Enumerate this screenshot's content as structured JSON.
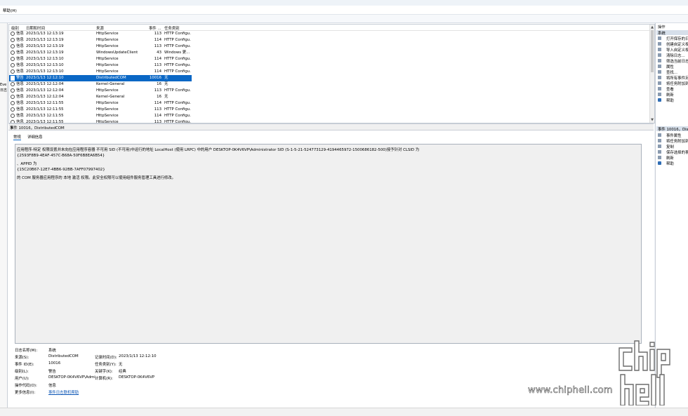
{
  "menu": {
    "help_label": "帮助(H)"
  },
  "left_pane": {
    "items": [
      "Eve",
      "日志"
    ]
  },
  "list": {
    "columns": {
      "level": "级别",
      "datetime": "日期和时间",
      "source": "来源",
      "event_id": "事件 ...",
      "task": "任务类别"
    },
    "rows": [
      {
        "level": "信息",
        "datetime": "2023/1/13 12:13:19",
        "source": "HttpService",
        "event_id": "113",
        "task": "HTTP Configu..."
      },
      {
        "level": "信息",
        "datetime": "2023/1/13 12:13:19",
        "source": "HttpService",
        "event_id": "114",
        "task": "HTTP Configu..."
      },
      {
        "level": "信息",
        "datetime": "2023/1/13 12:13:19",
        "source": "HttpService",
        "event_id": "113",
        "task": "HTTP Configu..."
      },
      {
        "level": "信息",
        "datetime": "2023/1/13 12:13:19",
        "source": "WindowsUpdateClient",
        "event_id": "43",
        "task": "Windows 更..."
      },
      {
        "level": "信息",
        "datetime": "2023/1/13 12:13:10",
        "source": "HttpService",
        "event_id": "114",
        "task": "HTTP Configu..."
      },
      {
        "level": "信息",
        "datetime": "2023/1/13 12:13:10",
        "source": "HttpService",
        "event_id": "113",
        "task": "HTTP Configu..."
      },
      {
        "level": "信息",
        "datetime": "2023/1/13 12:13:10",
        "source": "HttpService",
        "event_id": "114",
        "task": "HTTP Configu..."
      },
      {
        "level": "警告",
        "datetime": "2023/1/13 12:12:10",
        "source": "DistributedCOM",
        "event_id": "10016",
        "task": "无"
      },
      {
        "level": "信息",
        "datetime": "2023/1/13 12:12:04",
        "source": "Kernel-General",
        "event_id": "16",
        "task": "无"
      },
      {
        "level": "信息",
        "datetime": "2023/1/13 12:12:04",
        "source": "HttpService",
        "event_id": "113",
        "task": "HTTP Configu..."
      },
      {
        "level": "信息",
        "datetime": "2023/1/13 12:12:04",
        "source": "Kernel-General",
        "event_id": "16",
        "task": "无"
      },
      {
        "level": "信息",
        "datetime": "2023/1/13 12:11:55",
        "source": "HttpService",
        "event_id": "114",
        "task": "HTTP Configu..."
      },
      {
        "level": "信息",
        "datetime": "2023/1/13 12:11:55",
        "source": "HttpService",
        "event_id": "113",
        "task": "HTTP Configu..."
      },
      {
        "level": "信息",
        "datetime": "2023/1/13 12:11:55",
        "source": "HttpService",
        "event_id": "114",
        "task": "HTTP Configu..."
      },
      {
        "level": "信息",
        "datetime": "2023/1/13 12:11:55",
        "source": "HttpService",
        "event_id": "113",
        "task": "HTTP Configu..."
      }
    ]
  },
  "detail": {
    "title": "事件 10016，DistributedCOM",
    "tabs": [
      "常规",
      "详细信息"
    ],
    "description": [
      "应用程序-特定 权限设置并未向在应用程序容器 不可用 SID (不可用)中运行的地址 LocalHost (使用 LRPC) 中的用户 DESKTOP-0K4V6VP\\Administrator SID (S-1-5-21-524773129-4194465972-1500686182-500)授予针对 CLSID 为",
      "{2593F8B9-4EAF-457C-B68A-50F6B8EA6B54}",
      "、APPID 为",
      "{15C20B67-12E7-4BB6-92BB-7AFF07997402}",
      "的 COM 服务器应用程序的 本地 激活 权限。此安全权限可以使用组件服务管理工具进行修改。"
    ],
    "fields": {
      "log_name_label": "日志名称(M):",
      "log_name": "系统",
      "source_label": "来源(S):",
      "source": "DistributedCOM",
      "logged_label": "记录时间(D):",
      "logged": "2023/1/13 12:12:10",
      "event_id_label": "事件 ID(E):",
      "event_id": "10016",
      "task_label": "任务类别(Y):",
      "task": "无",
      "level_label": "级别(L):",
      "level": "警告",
      "keywords_label": "关键字(K):",
      "keywords": "经典",
      "user_label": "用户(U):",
      "user": "DESKTOP-0K4V6VP\\Admi",
      "computer_label": "计算机(R):",
      "computer": "DESKTOP-0K4V6VP",
      "opcode_label": "操作代码(O):",
      "opcode": "信息",
      "more_info_label": "更多信息(I):",
      "more_info_link": "事件日志联机帮助"
    }
  },
  "actions": {
    "title": "操作",
    "section1": "系统",
    "items1": [
      "打开保存的日志...",
      "创建自定义视图...",
      "导入自定义视图...",
      "清除日志...",
      "筛选当前日志...",
      "属性",
      "查找...",
      "将所有事件另存为...",
      "将任务附加到此日志...",
      "查看",
      "刷新",
      "帮助"
    ],
    "section2": "事件 10016，DistributedCOM",
    "items2": [
      "事件属性",
      "将任务附加到此事件...",
      "复制",
      "保存选择的事件...",
      "刷新",
      "帮助"
    ]
  },
  "watermark": {
    "text": "www.chiphell.com"
  },
  "colors": {
    "selection": "#0a67c5",
    "link": "#0b55b5",
    "pane_header": "#d6dfea"
  }
}
